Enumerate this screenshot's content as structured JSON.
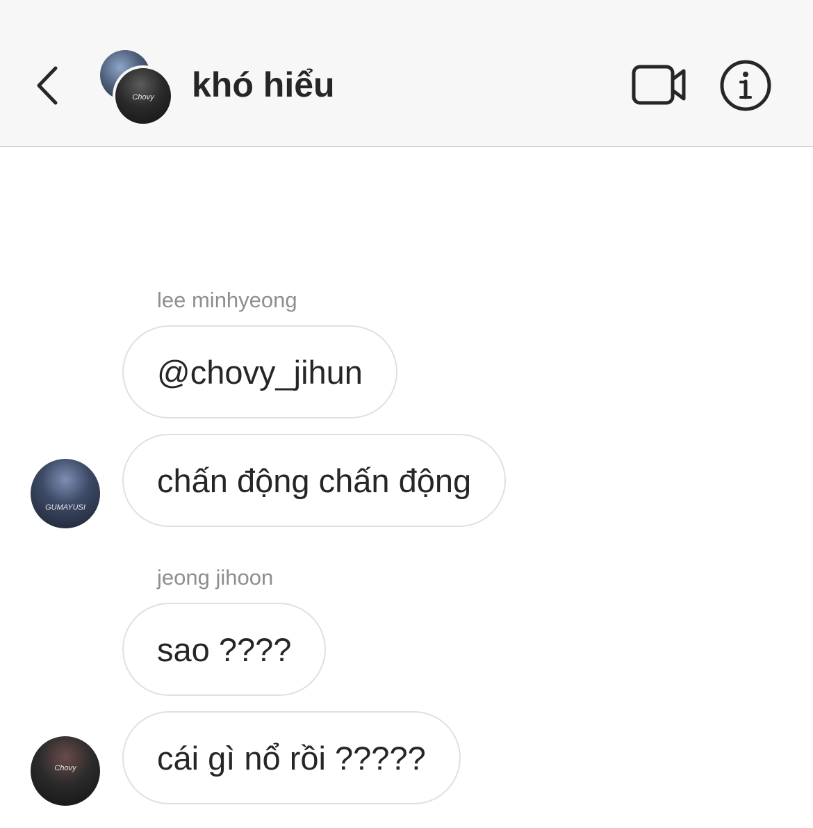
{
  "header": {
    "chat_title": "khó hiểu",
    "back_icon": "chevron-left-icon",
    "video_icon": "video-camera-icon",
    "info_icon": "info-icon"
  },
  "messages": [
    {
      "sender": "lee minhyeong",
      "text": "@chovy_jihun"
    },
    {
      "sender": "",
      "text": "chấn động chấn động",
      "avatar_label": "GUMAYUSI"
    },
    {
      "sender": "jeong jihoon",
      "text": "sao ????"
    },
    {
      "sender": "",
      "text": "cái gì nổ rồi ?????",
      "avatar_label": "Chovy"
    }
  ],
  "group_avatar_label": "Chovy"
}
